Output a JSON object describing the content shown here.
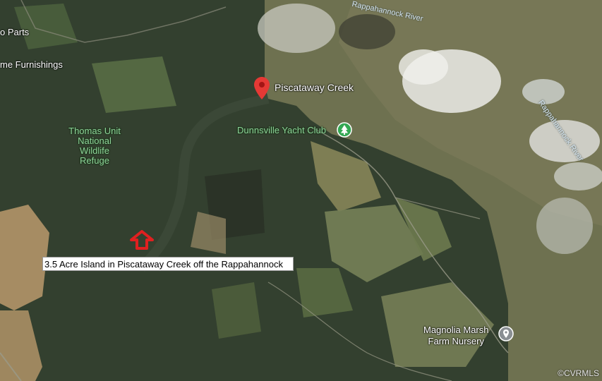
{
  "map": {
    "labels": {
      "auto_parts": "o Parts",
      "furnishings": "me Furnishings",
      "refuge": [
        "Thomas Unit",
        "National",
        "Wildlife",
        "Refuge"
      ],
      "pin_creek": "Piscataway Creek",
      "yacht_club": "Dunnsville Yacht Club",
      "river_top": "Rappahannock River",
      "river_right": "Rappahannock River",
      "nursery": [
        "Magnolia Marsh",
        "Farm Nursery"
      ]
    },
    "caption": "3.5 Acre Island in Piscataway Creek  off the Rappahannock",
    "copyright": "©CVRMLS",
    "icons": {
      "red_pin": "map-pin-icon",
      "park": "tree-icon",
      "place": "location-icon",
      "arrow": "up-arrow-icon"
    },
    "colors": {
      "pin": "#e53935",
      "arrow": "#e02020",
      "park_green": "#34a853"
    }
  }
}
